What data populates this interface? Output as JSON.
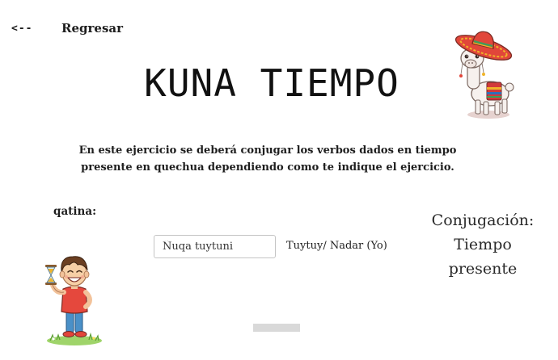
{
  "nav": {
    "back_arrow": "<--",
    "back_label": "Regresar"
  },
  "page_title": "KUNA TIEMPO",
  "instructions": "En este ejercicio se deberá conjugar los verbos dados en tiempo presente en quechua dependiendo como te indique el ejercicio.",
  "exercise": {
    "verb_label": "qatina:",
    "answer_value": "Ñuqa tuytuni",
    "hint": "Tuytuy/ Nadar (Yo)"
  },
  "side_heading": {
    "line1": "Conjugación:",
    "line2": "Tiempo",
    "line3": "presente"
  },
  "illustrations": {
    "top_right": "llama-with-sombrero-icon",
    "bottom_left": "boy-with-hourglass-icon"
  }
}
